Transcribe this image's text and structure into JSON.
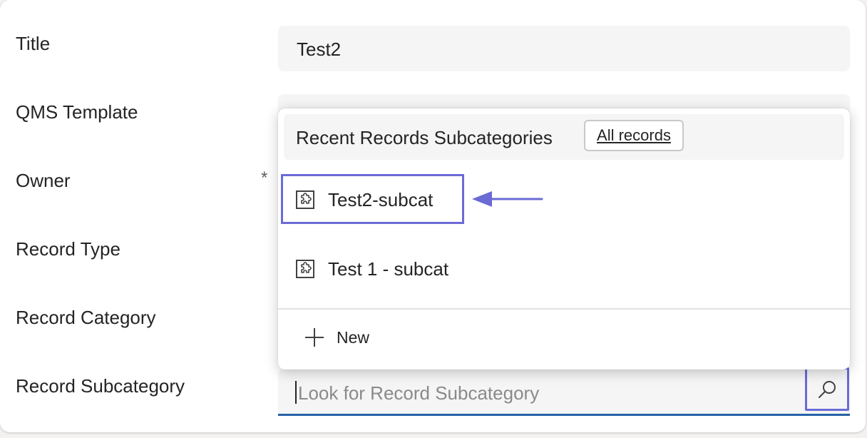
{
  "form": {
    "labels": {
      "title": "Title",
      "qms_template": "QMS Template",
      "owner": "Owner",
      "record_type": "Record Type",
      "record_category": "Record Category",
      "record_subcategory": "Record Subcategory"
    },
    "required_marker": "*",
    "title_value": "Test2",
    "subcategory_placeholder": "Look for Record Subcategory"
  },
  "flyout": {
    "header": "Recent Records Subcategories",
    "all_records_label": "All records",
    "items": [
      {
        "label": "Test2-subcat",
        "icon": "entity-icon"
      },
      {
        "label": "Test 1 - subcat",
        "icon": "entity-icon"
      }
    ],
    "new_label": "New"
  },
  "colors": {
    "accent_outline": "#6b6bd6",
    "input_underline": "#2563a8",
    "field_bg": "#f5f5f5"
  }
}
